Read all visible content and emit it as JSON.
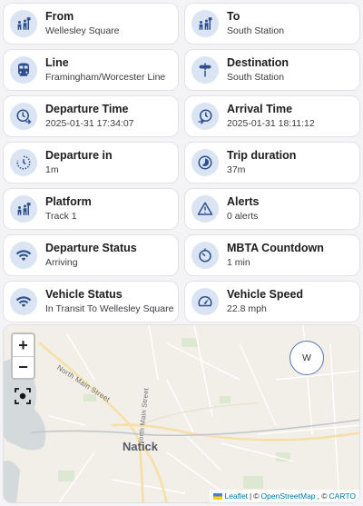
{
  "cards": [
    {
      "name": "from-card",
      "icon": "people-board-icon",
      "label": "From",
      "value": "Wellesley Square"
    },
    {
      "name": "to-card",
      "icon": "people-board-icon",
      "label": "To",
      "value": "South Station"
    },
    {
      "name": "line-card",
      "icon": "train-icon",
      "label": "Line",
      "value": "Framingham/Worcester Line"
    },
    {
      "name": "destination-card",
      "icon": "signpost-icon",
      "label": "Destination",
      "value": "South Station"
    },
    {
      "name": "departure-time-card",
      "icon": "clock-depart-icon",
      "label": "Departure Time",
      "value": "2025-01-31 17:34:07"
    },
    {
      "name": "arrival-time-card",
      "icon": "clock-arrive-icon",
      "label": "Arrival Time",
      "value": "2025-01-31 18:11:12"
    },
    {
      "name": "departure-in-card",
      "icon": "clock-refresh-icon",
      "label": "Departure in",
      "value": "1m"
    },
    {
      "name": "trip-duration-card",
      "icon": "timelapse-icon",
      "label": "Trip duration",
      "value": "37m"
    },
    {
      "name": "platform-card",
      "icon": "people-board-icon",
      "label": "Platform",
      "value": "Track 1"
    },
    {
      "name": "alerts-card",
      "icon": "alert-triangle-icon",
      "label": "Alerts",
      "value": "0 alerts"
    },
    {
      "name": "departure-status-card",
      "icon": "wifi-icon",
      "label": "Departure Status",
      "value": "Arriving"
    },
    {
      "name": "mbta-countdown-card",
      "icon": "timer-icon",
      "label": "MBTA Countdown",
      "value": "1 min"
    },
    {
      "name": "vehicle-status-card",
      "icon": "wifi-icon",
      "label": "Vehicle Status",
      "value": "In Transit To Wellesley Square"
    },
    {
      "name": "vehicle-speed-card",
      "icon": "speedometer-icon",
      "label": "Vehicle Speed",
      "value": "22.8 mph"
    }
  ],
  "map": {
    "zoom_in": "+",
    "zoom_out": "−",
    "marker_label": "W",
    "town_label": "Natick",
    "street_1": "North Main Street",
    "street_2": "North Main Street",
    "attribution": {
      "leaflet": "Leaflet",
      "sep1": "|",
      "copy1": "©",
      "osm": "OpenStreetMap",
      "copy2": ", ©",
      "carto": "CARTO"
    }
  },
  "colors": {
    "accent": "#2d4f8c",
    "icon_bg": "#dbe4f2",
    "water": "#d4dadc",
    "park": "#dde8d3",
    "link": "#0078a8"
  }
}
